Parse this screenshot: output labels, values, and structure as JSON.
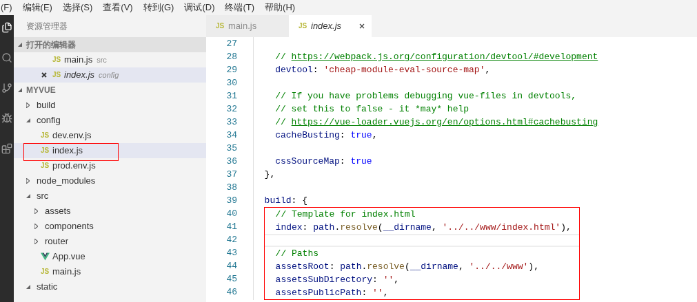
{
  "menu_bar": [
    "(F)",
    "编辑(E)",
    "选择(S)",
    "查看(V)",
    "转到(G)",
    "调试(D)",
    "终端(T)",
    "帮助(H)"
  ],
  "activity_bar": [
    {
      "kind": "files"
    },
    {
      "kind": "search"
    },
    {
      "kind": "git"
    },
    {
      "kind": "debug"
    },
    {
      "kind": "extensions"
    }
  ],
  "sidebar": {
    "title": "资源管理器",
    "open_editors": {
      "title": "打开的编辑器",
      "expanded": true,
      "items": [
        {
          "name": "main.js",
          "folder": "src",
          "kind": "js",
          "icon_text": "JS",
          "selected": false,
          "preview": false
        },
        {
          "name": "index.js",
          "folder": "config",
          "kind": "js",
          "icon_text": "JS",
          "selected": true,
          "preview": true
        }
      ]
    },
    "project": {
      "title": "MYVUE",
      "expanded": true,
      "tree": [
        {
          "kind": "folder",
          "name": "build",
          "expanded": false
        },
        {
          "kind": "folder",
          "name": "config",
          "expanded": true,
          "children": [
            {
              "kind": "js",
              "icon_text": "JS",
              "name": "dev.env.js",
              "selected": false,
              "boxed": false
            },
            {
              "kind": "js",
              "icon_text": "JS",
              "name": "index.js",
              "selected": true,
              "boxed": true
            },
            {
              "kind": "js",
              "icon_text": "JS",
              "name": "prod.env.js",
              "selected": false,
              "boxed": false
            }
          ]
        },
        {
          "kind": "folder",
          "name": "node_modules",
          "expanded": false
        },
        {
          "kind": "folder",
          "name": "src",
          "expanded": true,
          "children": [
            {
              "kind": "folder",
              "name": "assets",
              "expanded": false
            },
            {
              "kind": "folder",
              "name": "components",
              "expanded": false
            },
            {
              "kind": "folder",
              "name": "router",
              "expanded": false
            },
            {
              "kind": "vue",
              "name": "App.vue",
              "selected": false,
              "boxed": false
            },
            {
              "kind": "js",
              "icon_text": "JS",
              "name": "main.js",
              "selected": false,
              "boxed": false
            }
          ]
        },
        {
          "kind": "folder",
          "name": "static",
          "expanded": true
        }
      ]
    }
  },
  "tabs": [
    {
      "label": "main.js",
      "kind": "js",
      "icon_text": "JS",
      "selected": false,
      "preview": false
    },
    {
      "label": "index.js",
      "kind": "js",
      "icon_text": "JS",
      "selected": true,
      "preview": true
    }
  ],
  "editor": {
    "blocks": [
      {
        "boxed": false,
        "lines": [
          {
            "number": "27",
            "current": false
          },
          {
            "number": "28",
            "current": false,
            "tokens": [
              {
                "kind": "comment",
                "text": "    // "
              },
              {
                "kind": "link",
                "text": "https://webpack.js.org/configuration/devtool/#development"
              }
            ]
          },
          {
            "number": "29",
            "current": false,
            "tokens": [
              {
                "kind": "prop",
                "text": "    devtool"
              },
              {
                "kind": "punct",
                "text": ": "
              },
              {
                "kind": "string",
                "text": "'cheap-module-eval-source-map'"
              },
              {
                "kind": "punct",
                "text": ","
              }
            ]
          },
          {
            "number": "30",
            "current": false
          },
          {
            "number": "31",
            "current": false,
            "tokens": [
              {
                "kind": "comment",
                "text": "    // If you have problems debugging vue-files in devtools,"
              }
            ]
          },
          {
            "number": "32",
            "current": false,
            "tokens": [
              {
                "kind": "comment",
                "text": "    // set this to false - it *may* help"
              }
            ]
          },
          {
            "number": "33",
            "current": false,
            "tokens": [
              {
                "kind": "comment",
                "text": "    // "
              },
              {
                "kind": "link",
                "text": "https://vue-loader.vuejs.org/en/options.html#cachebusting"
              }
            ]
          },
          {
            "number": "34",
            "current": false,
            "tokens": [
              {
                "kind": "prop",
                "text": "    cacheBusting"
              },
              {
                "kind": "punct",
                "text": ": "
              },
              {
                "kind": "keyword",
                "text": "true"
              },
              {
                "kind": "punct",
                "text": ","
              }
            ]
          },
          {
            "number": "35",
            "current": false
          },
          {
            "number": "36",
            "current": false,
            "tokens": [
              {
                "kind": "prop",
                "text": "    cssSourceMap"
              },
              {
                "kind": "punct",
                "text": ": "
              },
              {
                "kind": "keyword",
                "text": "true"
              }
            ]
          },
          {
            "number": "37",
            "current": false,
            "tokens": [
              {
                "kind": "punct",
                "text": "  },"
              }
            ]
          },
          {
            "number": "38",
            "current": false
          },
          {
            "number": "39",
            "current": false,
            "tokens": [
              {
                "kind": "prop",
                "text": "  build"
              },
              {
                "kind": "punct",
                "text": ": {"
              }
            ]
          }
        ]
      },
      {
        "boxed": true,
        "lines": [
          {
            "number": "40",
            "current": false,
            "tokens": [
              {
                "kind": "comment",
                "text": "  // Template for index.html"
              }
            ]
          },
          {
            "number": "41",
            "current": false,
            "tokens": [
              {
                "kind": "prop",
                "text": "  index"
              },
              {
                "kind": "punct",
                "text": ": "
              },
              {
                "kind": "prop",
                "text": "path"
              },
              {
                "kind": "punct",
                "text": "."
              },
              {
                "kind": "func",
                "text": "resolve"
              },
              {
                "kind": "punct",
                "text": "("
              },
              {
                "kind": "prop",
                "text": "__dirname"
              },
              {
                "kind": "punct",
                "text": ", "
              },
              {
                "kind": "string",
                "text": "'../../www/index.html'"
              },
              {
                "kind": "punct",
                "text": "),"
              }
            ]
          },
          {
            "number": "42",
            "current": true
          },
          {
            "number": "43",
            "current": false,
            "tokens": [
              {
                "kind": "comment",
                "text": "  // Paths"
              }
            ]
          },
          {
            "number": "44",
            "current": false,
            "tokens": [
              {
                "kind": "prop",
                "text": "  assetsRoot"
              },
              {
                "kind": "punct",
                "text": ": "
              },
              {
                "kind": "prop",
                "text": "path"
              },
              {
                "kind": "punct",
                "text": "."
              },
              {
                "kind": "func",
                "text": "resolve"
              },
              {
                "kind": "punct",
                "text": "("
              },
              {
                "kind": "prop",
                "text": "__dirname"
              },
              {
                "kind": "punct",
                "text": ", "
              },
              {
                "kind": "string",
                "text": "'../../www'"
              },
              {
                "kind": "punct",
                "text": "),"
              }
            ]
          },
          {
            "number": "45",
            "current": false,
            "tokens": [
              {
                "kind": "prop",
                "text": "  assetsSubDirectory"
              },
              {
                "kind": "punct",
                "text": ": "
              },
              {
                "kind": "string",
                "text": "''"
              },
              {
                "kind": "punct",
                "text": ","
              }
            ]
          },
          {
            "number": "46",
            "current": false,
            "tokens": [
              {
                "kind": "prop",
                "text": "  assetsPublicPath"
              },
              {
                "kind": "punct",
                "text": ": "
              },
              {
                "kind": "string",
                "text": "''"
              },
              {
                "kind": "punct",
                "text": ","
              }
            ]
          }
        ]
      }
    ]
  }
}
